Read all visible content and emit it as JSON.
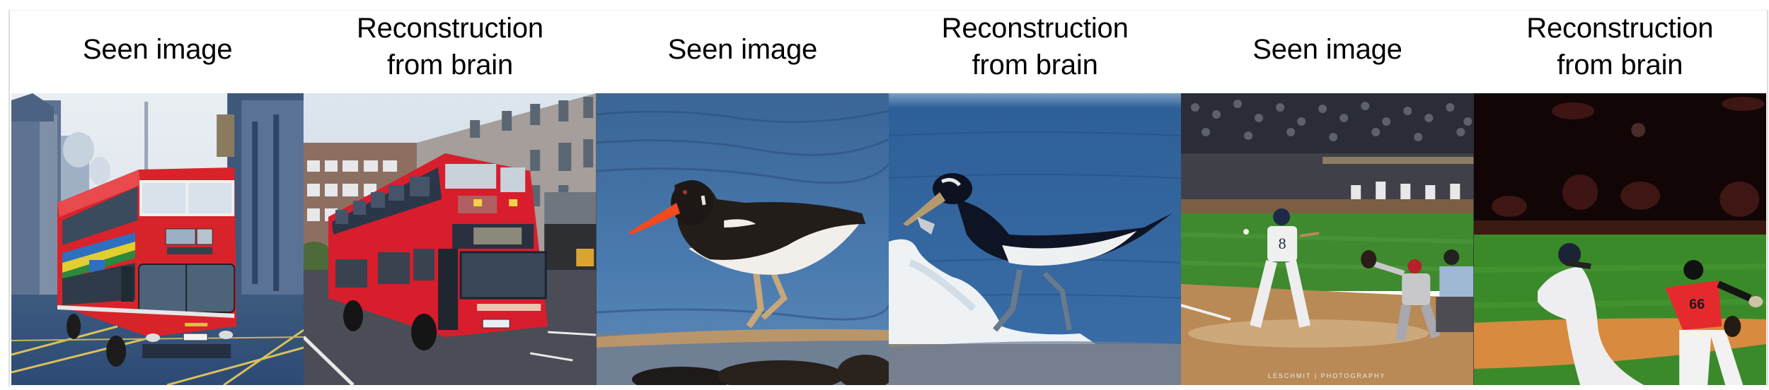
{
  "figure": {
    "columns": [
      {
        "header_line1": "Seen image",
        "header_line2": "",
        "kind": "seen",
        "image_description": "Red double-decker bus on a city street with stone buildings"
      },
      {
        "header_line1": "Reconstruction",
        "header_line2": "from brain",
        "kind": "reconstruction",
        "image_description": "Reconstructed red double-decker bus in front of buildings"
      },
      {
        "header_line1": "Seen image",
        "header_line2": "",
        "kind": "seen",
        "image_description": "Oystercatcher bird with orange beak wading in blue water"
      },
      {
        "header_line1": "Reconstruction",
        "header_line2": "from brain",
        "kind": "reconstruction",
        "image_description": "Reconstructed black and white wading bird splashing in water"
      },
      {
        "header_line1": "Seen image",
        "header_line2": "",
        "kind": "seen",
        "image_description": "Baseball batter, catcher and umpire at home plate with crowd",
        "watermark": "LESCHMIT | PHOTOGRAPHY"
      },
      {
        "header_line1": "Reconstruction",
        "header_line2": "from brain",
        "kind": "reconstruction",
        "image_description": "Reconstructed baseball players on green field with dark stands"
      }
    ],
    "colors": {
      "text": "#000000",
      "bus_red": "#d9232a",
      "water_blue": "#3f6fa5",
      "grass_green": "#3f8a2e",
      "infield_dirt": "#b98a55"
    }
  }
}
